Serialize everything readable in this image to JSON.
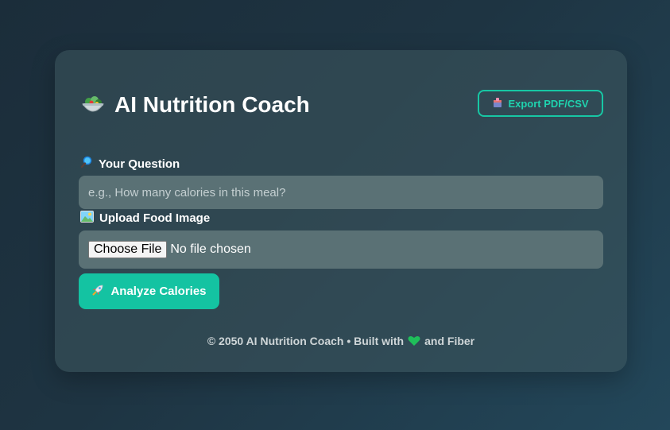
{
  "header": {
    "title": "AI Nutrition Coach",
    "title_icon": "salad-bowl-icon",
    "export_label": "Export PDF/CSV",
    "export_icon": "package-icon"
  },
  "question": {
    "label": "Your Question",
    "label_icon": "magnifier-icon",
    "placeholder": "e.g., How many calories in this meal?",
    "value": ""
  },
  "upload": {
    "label": "Upload Food Image",
    "label_icon": "picture-icon",
    "button_label": "Choose File",
    "status": "No file chosen"
  },
  "analyze": {
    "label": "Analyze Calories",
    "icon": "rocket-icon"
  },
  "footer": {
    "text_before": "© 2050 AI Nutrition Coach • Built with",
    "heart_icon": "green-heart-icon",
    "text_after": "and Fiber"
  },
  "colors": {
    "accent": "#14c3a2",
    "card": "#3e575e",
    "input_bg": "#5a7175",
    "heart": "#1fbf5a"
  }
}
